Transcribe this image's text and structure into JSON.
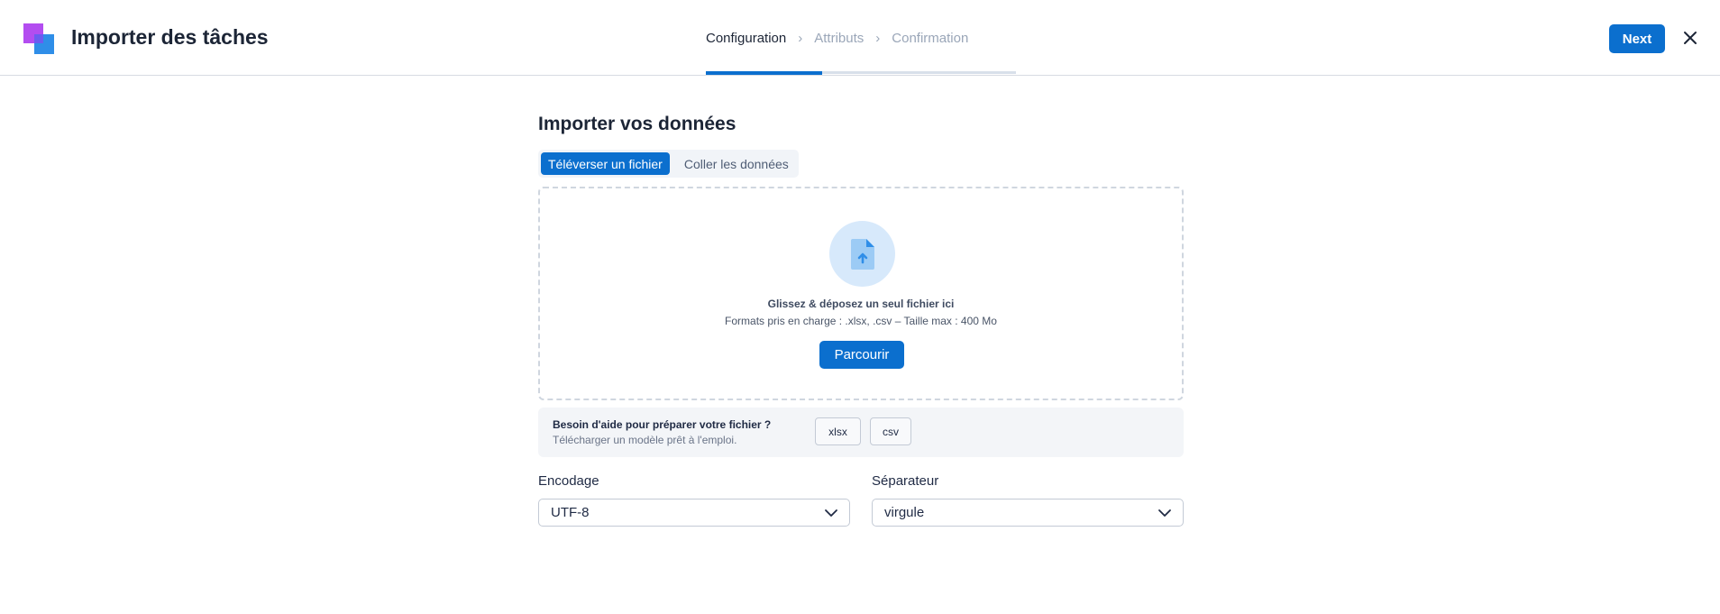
{
  "header": {
    "title": "Importer des tâches",
    "steps": [
      {
        "label": "Configuration",
        "state": "active"
      },
      {
        "label": "Attributs",
        "state": "inactive"
      },
      {
        "label": "Confirmation",
        "state": "inactive"
      }
    ],
    "next_label": "Next"
  },
  "main": {
    "title": "Importer vos données",
    "tabs": [
      {
        "label": "Téléverser un fichier",
        "active": true
      },
      {
        "label": "Coller les données",
        "active": false
      }
    ],
    "dropzone": {
      "title": "Glissez & déposez un seul fichier ici",
      "subtitle": "Formats pris en charge : .xlsx, .csv – Taille max : 400 Mo",
      "browse_label": "Parcourir"
    },
    "help": {
      "title": "Besoin d'aide pour préparer votre fichier ?",
      "subtitle": "Télécharger un modèle prêt à l'emploi.",
      "templates": [
        "xlsx",
        "csv"
      ]
    },
    "encoding": {
      "label": "Encodage",
      "value": "UTF-8"
    },
    "separator": {
      "label": "Séparateur",
      "value": "virgule"
    }
  },
  "colors": {
    "accent": "#0b6fce",
    "logo_purple": "#b34df0",
    "logo_blue": "#2f8ee8"
  },
  "icons": [
    "logo-icon",
    "chevron-right-icon",
    "close-icon",
    "file-upload-icon",
    "chevron-down-icon"
  ]
}
